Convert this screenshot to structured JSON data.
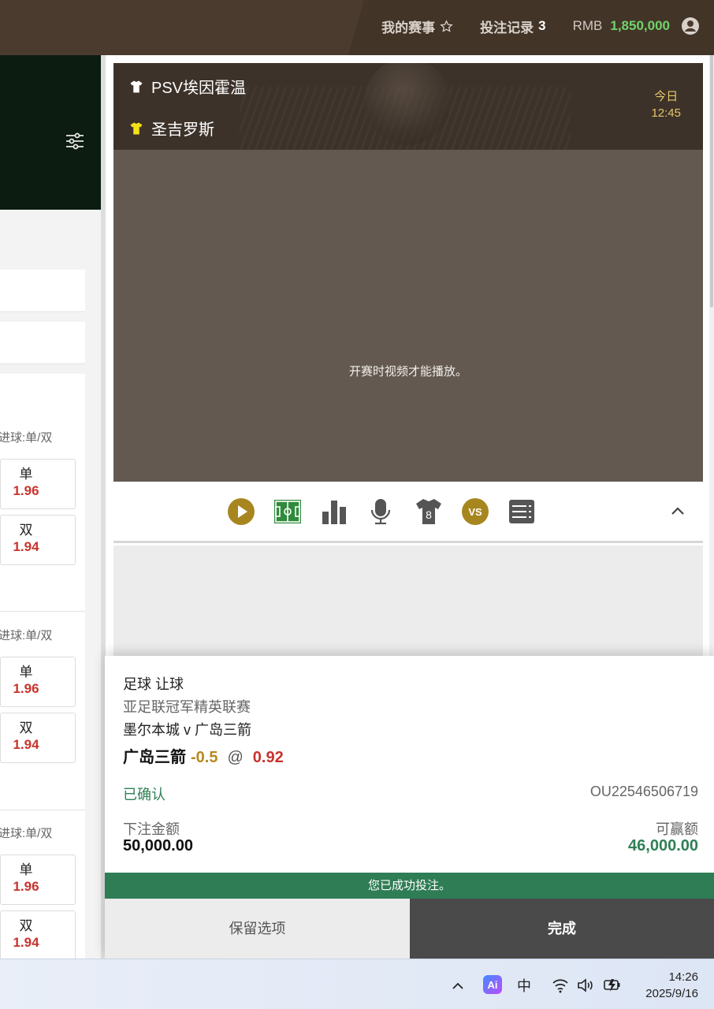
{
  "header": {
    "my_events": "我的赛事",
    "bet_record": "投注记录",
    "bet_record_count": "3",
    "currency": "RMB",
    "balance": "1,850,000",
    "icons": [
      "star-outline-icon",
      "account-icon"
    ]
  },
  "left": {
    "market_label": "进球:单/双",
    "groups": [
      {
        "odd_label": "单",
        "odd_value": "1.96",
        "even_label": "双",
        "even_value": "1.94"
      },
      {
        "odd_label": "单",
        "odd_value": "1.96",
        "even_label": "双",
        "even_value": "1.94"
      },
      {
        "odd_label": "单",
        "odd_value": "1.96",
        "even_label": "双",
        "even_value": "1.94"
      }
    ]
  },
  "match": {
    "home": "PSV埃因霍温",
    "away": "圣吉罗斯",
    "day": "今日",
    "time": "12:45",
    "video_message": "开赛时视频才能播放。"
  },
  "tools": [
    "play-icon",
    "pitch-icon",
    "stats-icon",
    "commentary-icon",
    "lineup-icon",
    "vs-icon",
    "scoreboard-icon",
    "chevron-up-icon"
  ],
  "tool_texts": {
    "lineup_number": "8",
    "vs": "VS"
  },
  "slip": {
    "sport_market": "足球 让球",
    "league": "亚足联冠军精英联赛",
    "fixture": "墨尔本城 v 广岛三箭",
    "selection": "广岛三箭",
    "handicap": "-0.5",
    "at": "@",
    "odds": "0.92",
    "status": "已确认",
    "reference": "OU22546506719",
    "stake_label": "下注金额",
    "stake": "50,000.00",
    "win_label": "可赢额",
    "win": "46,000.00",
    "success_message": "您已成功投注。",
    "keep_label": "保留选项",
    "done_label": "完成"
  },
  "taskbar": {
    "ime": "中",
    "ai_label": "Ai",
    "time": "14:26",
    "date": "2025/9/16"
  },
  "colors": {
    "header_bg": "#4b3b2e",
    "balance": "#6fd36a",
    "odds_red": "#c8332c",
    "handicap_gold": "#b58a1e",
    "confirmed_green": "#2f8056",
    "success_bar": "#2f7d55",
    "icon_gold": "#a8861f",
    "icon_green": "#2f8a3c"
  }
}
